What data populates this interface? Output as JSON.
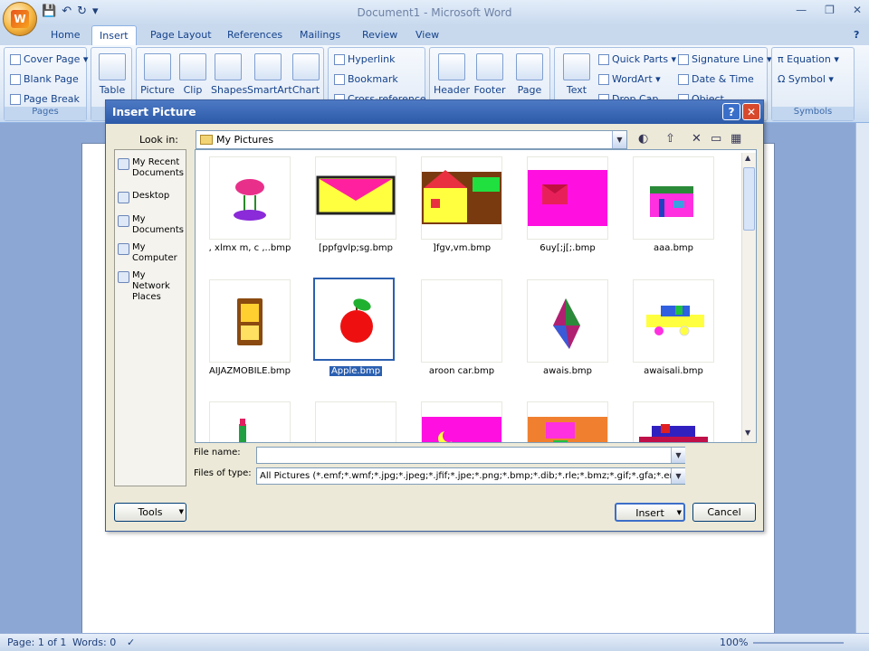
{
  "window": {
    "title": "Document1 - Microsoft Word",
    "minimize": "—",
    "restore": "❐",
    "close": "✕"
  },
  "qat": {
    "save": "💾",
    "undo": "↶",
    "redo": "↻",
    "more": "▾"
  },
  "tabs": [
    "Home",
    "Insert",
    "Page Layout",
    "References",
    "Mailings",
    "Review",
    "View"
  ],
  "active_tab": "Insert",
  "ribbon": {
    "pages_group": {
      "label": "Pages",
      "items": [
        "Cover Page",
        "Blank Page",
        "Page Break"
      ]
    },
    "tables_group": {
      "table": "Table",
      "label": "T"
    },
    "illustrations": [
      "Picture",
      "Clip",
      "Shapes",
      "SmartArt",
      "Chart"
    ],
    "links": [
      "Hyperlink",
      "Bookmark",
      "Cross-reference"
    ],
    "header_footer": [
      "Header",
      "Footer",
      "Page"
    ],
    "text_group": {
      "text": "Text",
      "items": [
        "Quick Parts",
        "WordArt",
        "Drop Cap"
      ],
      "items2": [
        "Signature Line",
        "Date & Time",
        "Object"
      ]
    },
    "symbols_group": {
      "label": "Symbols",
      "items": [
        "Equation",
        "Symbol"
      ]
    }
  },
  "dialog": {
    "title": "Insert Picture",
    "help": "?",
    "close": "✕",
    "look_in_label": "Look in:",
    "look_in_value": "My Pictures",
    "places": [
      "My Recent Documents",
      "Desktop",
      "My Documents",
      "My Computer",
      "My Network Places"
    ],
    "files": [
      ", xlmx m, c ,..bmp",
      "[ppfgvlp;sg.bmp",
      "]fgv,vm.bmp",
      "6uy[;j[;.bmp",
      "aaa.bmp",
      "AIJAZMOBILE.bmp",
      "Apple.bmp",
      "aroon car.bmp",
      "awais.bmp",
      "awaisali.bmp"
    ],
    "selected_file": "Apple.bmp",
    "file_name_label": "File name:",
    "file_name_value": "",
    "files_of_type_label": "Files of type:",
    "files_of_type_value": "All Pictures (*.emf;*.wmf;*.jpg;*.jpeg;*.jfif;*.jpe;*.png;*.bmp;*.dib;*.rle;*.bmz;*.gif;*.gfa;*.emz",
    "tools_label": "Tools",
    "insert_label": "Insert",
    "cancel_label": "Cancel"
  },
  "statusbar": {
    "page": "Page: 1 of 1",
    "words": "Words: 0",
    "zoom": "100%"
  }
}
